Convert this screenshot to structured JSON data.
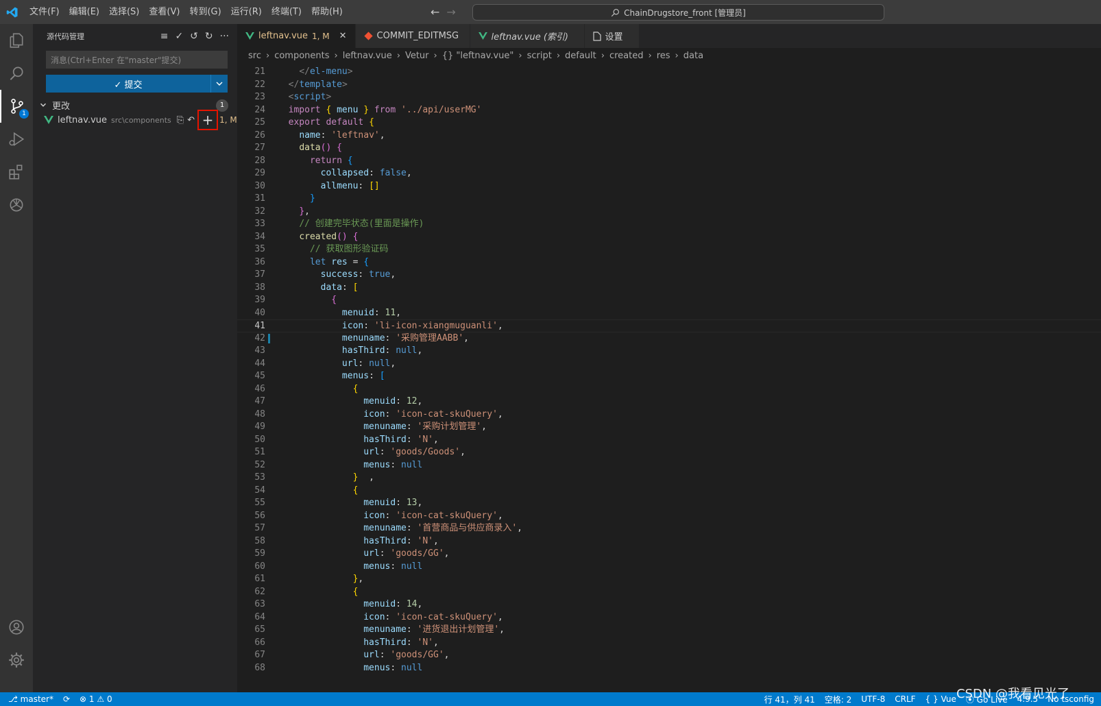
{
  "titlebar": {
    "menus": [
      "文件(F)",
      "编辑(E)",
      "选择(S)",
      "查看(V)",
      "转到(G)",
      "运行(R)",
      "终端(T)",
      "帮助(H)"
    ],
    "search": "ChainDrugstore_front [管理员]"
  },
  "activity": {
    "scm_badge": "1"
  },
  "sidebar": {
    "title": "源代码管理",
    "message_placeholder": "消息(Ctrl+Enter 在\"master\"提交)",
    "commit_label": "✓ 提交",
    "changes_label": "更改",
    "changes_count": "1",
    "file": {
      "name": "leftnav.vue",
      "path": "src\\components",
      "status": "1, M"
    }
  },
  "tabs": [
    {
      "label": "leftnav.vue",
      "suffix": "1, M",
      "icon": "vue-icon",
      "active": true
    },
    {
      "label": "COMMIT_EDITMSG",
      "icon": "git-icon"
    },
    {
      "label": "leftnav.vue (索引)",
      "icon": "vue-icon"
    },
    {
      "label": "设置",
      "icon": "file-icon"
    }
  ],
  "breadcrumb": [
    "src",
    "components",
    "leftnav.vue",
    "Vetur",
    "{} \"leftnav.vue\"",
    "script",
    "default",
    "created",
    "res",
    "data"
  ],
  "code_lines": [
    {
      "n": 21,
      "h": "    <span class='t'>&lt;/</span><span class='k'>el-menu</span><span class='t'>&gt;</span>"
    },
    {
      "n": 22,
      "h": "  <span class='t'>&lt;/</span><span class='k'>template</span><span class='t'>&gt;</span>"
    },
    {
      "n": 23,
      "h": "  <span class='t'>&lt;</span><span class='k'>script</span><span class='t'>&gt;</span>"
    },
    {
      "n": 24,
      "h": "  <span class='kw'>import</span> <span class='b1'>{</span> <span class='p'>menu</span> <span class='b1'>}</span> <span class='kw'>from</span> <span class='s'>'../api/userMG'</span>"
    },
    {
      "n": 25,
      "h": "  <span class='kw'>export</span> <span class='kw'>default</span> <span class='b1'>{</span>"
    },
    {
      "n": 26,
      "h": "    <span class='p'>name</span><span class='w'>:</span> <span class='s'>'leftnav'</span><span class='w'>,</span>"
    },
    {
      "n": 27,
      "h": "    <span class='f'>data</span><span class='b2'>()</span> <span class='b2'>{</span>"
    },
    {
      "n": 28,
      "h": "      <span class='kw'>return</span> <span class='b3'>{</span>"
    },
    {
      "n": 29,
      "h": "        <span class='p'>collapsed</span><span class='w'>:</span> <span class='k'>false</span><span class='w'>,</span>"
    },
    {
      "n": 30,
      "h": "        <span class='p'>allmenu</span><span class='w'>:</span> <span class='b1'>[]</span>"
    },
    {
      "n": 31,
      "h": "      <span class='b3'>}</span>"
    },
    {
      "n": 32,
      "h": "    <span class='b2'>}</span><span class='w'>,</span>"
    },
    {
      "n": 33,
      "h": "    <span class='c'>// 创建完毕状态(里面是操作)</span>"
    },
    {
      "n": 34,
      "h": "    <span class='f'>created</span><span class='b2'>()</span> <span class='b2'>{</span>"
    },
    {
      "n": 35,
      "h": "      <span class='c'>// 获取图形验证码</span>"
    },
    {
      "n": 36,
      "h": "      <span class='k'>let</span> <span class='p'>res</span> <span class='w'>=</span> <span class='b3'>{</span>"
    },
    {
      "n": 37,
      "h": "        <span class='p'>success</span><span class='w'>:</span> <span class='k'>true</span><span class='w'>,</span>"
    },
    {
      "n": 38,
      "h": "        <span class='p'>data</span><span class='w'>:</span> <span class='b1'>[</span>"
    },
    {
      "n": 39,
      "h": "          <span class='b2'>{</span>"
    },
    {
      "n": 40,
      "h": "            <span class='p'>menuid</span><span class='w'>:</span> <span class='n'>11</span><span class='w'>,</span>"
    },
    {
      "n": 41,
      "h": "            <span class='p'>icon</span><span class='w'>:</span> <span class='s'>'li-icon-xiangmuguanli'</span><span class='w'>,</span>"
    },
    {
      "n": 42,
      "h": "            <span class='p'>menuname</span><span class='w'>:</span> <span class='s'>'采购管理AABB'</span><span class='w'>,</span>"
    },
    {
      "n": 43,
      "h": "            <span class='p'>hasThird</span><span class='w'>:</span> <span class='k'>null</span><span class='w'>,</span>"
    },
    {
      "n": 44,
      "h": "            <span class='p'>url</span><span class='w'>:</span> <span class='k'>null</span><span class='w'>,</span>"
    },
    {
      "n": 45,
      "h": "            <span class='p'>menus</span><span class='w'>:</span> <span class='b3'>[</span>"
    },
    {
      "n": 46,
      "h": "              <span class='b1'>{</span>"
    },
    {
      "n": 47,
      "h": "                <span class='p'>menuid</span><span class='w'>:</span> <span class='n'>12</span><span class='w'>,</span>"
    },
    {
      "n": 48,
      "h": "                <span class='p'>icon</span><span class='w'>:</span> <span class='s'>'icon-cat-skuQuery'</span><span class='w'>,</span>"
    },
    {
      "n": 49,
      "h": "                <span class='p'>menuname</span><span class='w'>:</span> <span class='s'>'采购计划管理'</span><span class='w'>,</span>"
    },
    {
      "n": 50,
      "h": "                <span class='p'>hasThird</span><span class='w'>:</span> <span class='s'>'N'</span><span class='w'>,</span>"
    },
    {
      "n": 51,
      "h": "                <span class='p'>url</span><span class='w'>:</span> <span class='s'>'goods/Goods'</span><span class='w'>,</span>"
    },
    {
      "n": 52,
      "h": "                <span class='p'>menus</span><span class='w'>:</span> <span class='k'>null</span>"
    },
    {
      "n": 53,
      "h": "              <span class='b1'>}</span>  <span class='w'>,</span>"
    },
    {
      "n": 54,
      "h": "              <span class='b1'>{</span>"
    },
    {
      "n": 55,
      "h": "                <span class='p'>menuid</span><span class='w'>:</span> <span class='n'>13</span><span class='w'>,</span>"
    },
    {
      "n": 56,
      "h": "                <span class='p'>icon</span><span class='w'>:</span> <span class='s'>'icon-cat-skuQuery'</span><span class='w'>,</span>"
    },
    {
      "n": 57,
      "h": "                <span class='p'>menuname</span><span class='w'>:</span> <span class='s'>'首营商品与供应商录入'</span><span class='w'>,</span>"
    },
    {
      "n": 58,
      "h": "                <span class='p'>hasThird</span><span class='w'>:</span> <span class='s'>'N'</span><span class='w'>,</span>"
    },
    {
      "n": 59,
      "h": "                <span class='p'>url</span><span class='w'>:</span> <span class='s'>'goods/GG'</span><span class='w'>,</span>"
    },
    {
      "n": 60,
      "h": "                <span class='p'>menus</span><span class='w'>:</span> <span class='k'>null</span>"
    },
    {
      "n": 61,
      "h": "              <span class='b1'>}</span><span class='w'>,</span>"
    },
    {
      "n": 62,
      "h": "              <span class='b1'>{</span>"
    },
    {
      "n": 63,
      "h": "                <span class='p'>menuid</span><span class='w'>:</span> <span class='n'>14</span><span class='w'>,</span>"
    },
    {
      "n": 64,
      "h": "                <span class='p'>icon</span><span class='w'>:</span> <span class='s'>'icon-cat-skuQuery'</span><span class='w'>,</span>"
    },
    {
      "n": 65,
      "h": "                <span class='p'>menuname</span><span class='w'>:</span> <span class='s'>'进货退出计划管理'</span><span class='w'>,</span>"
    },
    {
      "n": 66,
      "h": "                <span class='p'>hasThird</span><span class='w'>:</span> <span class='s'>'N'</span><span class='w'>,</span>"
    },
    {
      "n": 67,
      "h": "                <span class='p'>url</span><span class='w'>:</span> <span class='s'>'goods/GG'</span><span class='w'>,</span>"
    },
    {
      "n": 68,
      "h": "                <span class='p'>menus</span><span class='w'>:</span> <span class='k'>null</span>"
    }
  ],
  "status": {
    "branch": "master*",
    "problems": "⊗ 1 ⚠ 0",
    "position": "行 41，列 41",
    "spaces": "空格: 2",
    "encoding": "UTF-8",
    "eol": "CRLF",
    "language": "Vue",
    "golive": "Go Live",
    "version": "4.9.5",
    "tsconfig": "No tsconfig"
  },
  "watermark": "CSDN @我看见光了"
}
